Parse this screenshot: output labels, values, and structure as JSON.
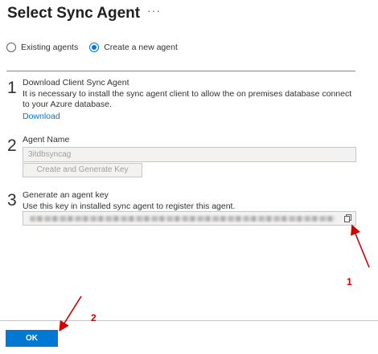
{
  "header": {
    "title": "Select Sync Agent",
    "more_label": "···"
  },
  "options": {
    "existing_label": "Existing agents",
    "create_label": "Create a new agent",
    "selected": "create"
  },
  "step1": {
    "number": "1",
    "title": "Download Client Sync Agent",
    "description": "It is necessary to install the sync agent client to allow the on premises database connect to your Azure database.",
    "link": "Download"
  },
  "step2": {
    "number": "2",
    "title": "Agent Name",
    "agent_name_value": "3itdbsyncag",
    "button_label": "Create and Generate Key"
  },
  "step3": {
    "number": "3",
    "title": "Generate an agent key",
    "description": "Use this key in installed sync agent to register this agent."
  },
  "footer": {
    "ok_label": "OK"
  },
  "annotations": {
    "label_1": "1",
    "label_2": "2",
    "color": "#d10000"
  },
  "icons": {
    "copy": "copy-icon",
    "more": "more-icon"
  }
}
